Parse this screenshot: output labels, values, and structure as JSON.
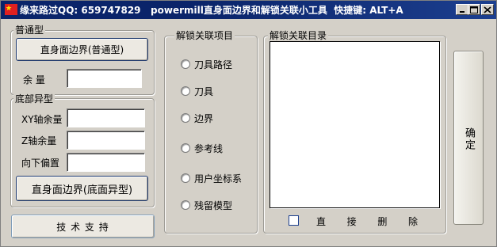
{
  "window": {
    "title": "缘来路过QQ: 659747829   powermill直身面边界和解锁关联小工具  快捷键: ALT+A",
    "icon": "china-flag-icon",
    "controls": [
      "minimize-icon",
      "maximize-icon",
      "close-icon"
    ]
  },
  "left_panel": {
    "normal_group": {
      "label": "普通型",
      "button_label": "直身面边界(普通型)",
      "allowance_label": "余  量",
      "allowance_value": ""
    },
    "bottom_group": {
      "label": "底部异型",
      "xy_label": "XY轴余量",
      "xy_value": "",
      "z_label": "Z轴余量",
      "z_value": "",
      "offset_label": "向下偏置",
      "offset_value": "",
      "button_label": "直身面边界(底面异型)"
    },
    "support_button_label": "技 术 支 持"
  },
  "unlock_items": {
    "label": "解锁关联项目",
    "options": [
      "刀具路径",
      "刀具",
      "边界",
      "参考线",
      "用户坐标系",
      "残留模型"
    ]
  },
  "unlock_directory": {
    "label": "解锁关联目录",
    "items": [],
    "direct_delete_label": [
      "直",
      "接",
      "删",
      "除"
    ]
  },
  "confirm_button_label": "确定",
  "colors": {
    "title_bar": "#0a246a",
    "window_bg": "#d4d0c8",
    "flag_red": "#e02020",
    "flag_star": "#ffde00"
  }
}
